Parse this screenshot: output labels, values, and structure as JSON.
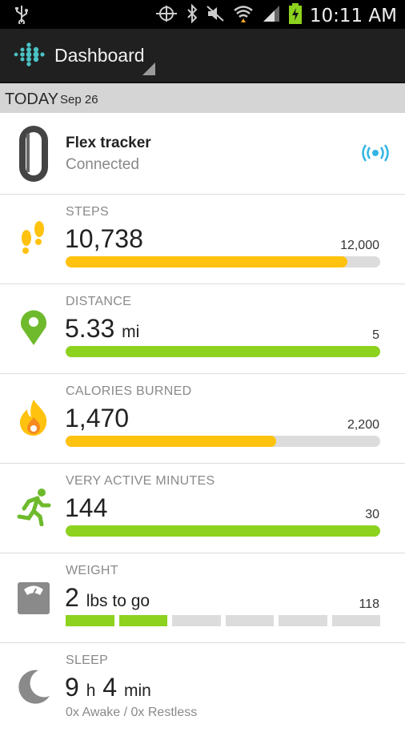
{
  "status_bar": {
    "time": "10:11 AM",
    "icons": [
      "usb-icon",
      "sync-icon",
      "bluetooth-icon",
      "mute-icon",
      "wifi-icon",
      "signal-icon",
      "battery-icon"
    ]
  },
  "action_bar": {
    "title": "Dashboard",
    "icons": [
      "fitbit-logo-icon",
      "dropdown-caret-icon"
    ]
  },
  "date_header": {
    "today_label": "TODAY",
    "date": "Sep 26"
  },
  "tracker": {
    "name": "Flex tracker",
    "status": "Connected",
    "icons": [
      "flex-band-icon",
      "wireless-sync-icon"
    ]
  },
  "metrics": [
    {
      "label": "STEPS",
      "value": "10,738",
      "unit": "",
      "goal": "12,000",
      "progress": 0.895,
      "color": "#ffc20e",
      "icon": "footsteps-icon"
    },
    {
      "label": "DISTANCE",
      "value": "5.33",
      "unit": "mi",
      "goal": "5",
      "progress": 1.0,
      "color": "#8cd21e",
      "icon": "map-pin-icon"
    },
    {
      "label": "CALORIES BURNED",
      "value": "1,470",
      "unit": "",
      "goal": "2,200",
      "progress": 0.668,
      "color": "#ffc20e",
      "icon": "flame-icon"
    },
    {
      "label": "VERY ACTIVE MINUTES",
      "value": "144",
      "unit": "",
      "goal": "30",
      "progress": 1.0,
      "color": "#8cd21e",
      "icon": "running-person-icon"
    }
  ],
  "weight": {
    "label": "WEIGHT",
    "value": "2",
    "unit": "lbs to go",
    "goal": "118",
    "segments_filled": 2,
    "segments_total": 6,
    "color": "#8cd21e",
    "icon": "scale-icon"
  },
  "sleep": {
    "label": "SLEEP",
    "hours": "9",
    "hours_unit": "h",
    "minutes": "4",
    "minutes_unit": "min",
    "detail": "0x Awake / 0x Restless",
    "icon": "moon-icon"
  }
}
